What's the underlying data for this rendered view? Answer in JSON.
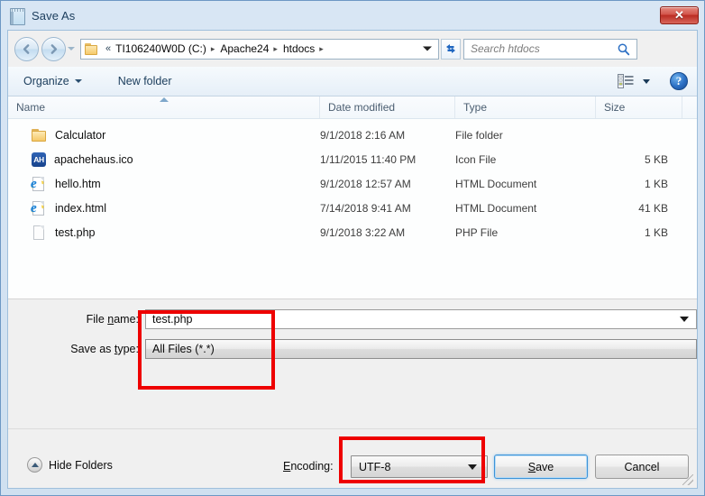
{
  "window": {
    "title": "Save As",
    "title_icon": "notepad-icon",
    "close_label": "✕"
  },
  "navigation": {
    "back_icon": "arrow-left-icon",
    "forward_icon": "arrow-right-icon",
    "history_dropdown_icon": "chevron-down-icon",
    "breadcrumb_prefix": "«",
    "breadcrumbs": [
      {
        "label": "TI106240W0D (C:)"
      },
      {
        "label": "Apache24"
      },
      {
        "label": "htdocs"
      }
    ],
    "breadcrumb_separator": "▸",
    "address_dropdown_icon": "chevron-down-icon",
    "refresh_icon": "refresh-icon",
    "folder_icon": "folder-icon"
  },
  "search": {
    "placeholder": "Search htdocs",
    "icon": "search-icon"
  },
  "toolbar": {
    "organize_label": "Organize",
    "new_folder_label": "New folder",
    "view_icon": "list-view-icon",
    "view_dropdown_icon": "chevron-down-icon",
    "help_label": "?",
    "help_icon": "help-icon"
  },
  "filelist": {
    "columns": [
      {
        "key": "name",
        "label": "Name"
      },
      {
        "key": "date",
        "label": "Date modified"
      },
      {
        "key": "type",
        "label": "Type"
      },
      {
        "key": "size",
        "label": "Size"
      }
    ],
    "sort_column": "Name",
    "sort_direction": "ascending",
    "rows": [
      {
        "icon": "folder-icon",
        "name": "Calculator",
        "date": "9/1/2018 2:16 AM",
        "type": "File folder",
        "size": ""
      },
      {
        "icon": "apachehaus-icon",
        "name": "apachehaus.ico",
        "date": "1/11/2015 11:40 PM",
        "type": "Icon File",
        "size": "5 KB",
        "icon_text": "AH"
      },
      {
        "icon": "ie-document-icon",
        "name": "hello.htm",
        "date": "9/1/2018 12:57 AM",
        "type": "HTML Document",
        "size": "1 KB"
      },
      {
        "icon": "ie-document-icon",
        "name": "index.html",
        "date": "7/14/2018 9:41 AM",
        "type": "HTML Document",
        "size": "41 KB"
      },
      {
        "icon": "blank-page-icon",
        "name": "test.php",
        "date": "9/1/2018 3:22 AM",
        "type": "PHP File",
        "size": "1 KB"
      }
    ]
  },
  "form": {
    "filename_label_pre": "File ",
    "filename_label_accel": "n",
    "filename_label_post": "ame:",
    "filename_value": "test.php",
    "filetype_label_pre": "Save as ",
    "filetype_label_accel": "t",
    "filetype_label_post": "ype:",
    "filetype_value": "All Files  (*.*)",
    "dropdown_icon": "chevron-down-icon"
  },
  "footer": {
    "hide_folders_label": "Hide Folders",
    "hide_folders_icon": "chevron-up-circle-icon",
    "encoding_label_accel": "E",
    "encoding_label_post": "ncoding:",
    "encoding_value": "UTF-8",
    "encoding_dropdown_icon": "chevron-down-icon",
    "save_label_accel": "S",
    "save_label_post": "ave",
    "cancel_label": "Cancel",
    "resize_grip_icon": "resize-grip-icon"
  },
  "annotations": {
    "highlight_color": "#ee0000",
    "boxes": [
      {
        "id": "filename-highlight",
        "target": "File name and Save as type fields"
      },
      {
        "id": "encoding-highlight",
        "target": "Encoding combo box"
      }
    ]
  }
}
